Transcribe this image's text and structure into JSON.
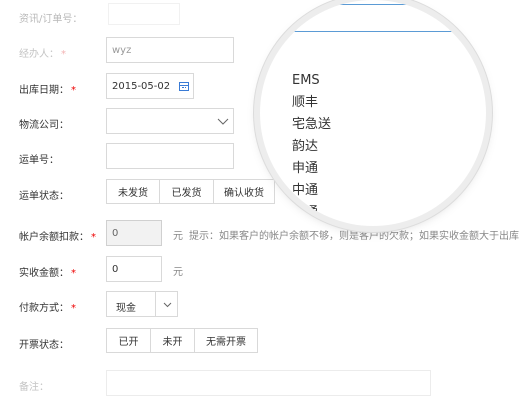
{
  "form": {
    "order_no": {
      "label": "资讯/订单号：",
      "value": ""
    },
    "handler": {
      "label": "经办人：",
      "required": "*",
      "value": "wyz"
    },
    "ship_date": {
      "label": "出库日期：",
      "required": "*",
      "value": "2015-05-02",
      "icon": "calendar-icon"
    },
    "logistics": {
      "label": "物流公司：",
      "icon": "chevron-down-icon"
    },
    "tracking_no": {
      "label": "运单号："
    },
    "shipping_status": {
      "label": "运单状态：",
      "options": [
        "未发货",
        "已发货",
        "确认收货"
      ]
    },
    "balance_deduct": {
      "label": "帐户余额扣款：",
      "required": "*",
      "value": "0",
      "unit": "元",
      "hint": "提示：如果客户的帐户余额不够，则是客户的欠款；如果实收金额大于出库"
    },
    "received_amount": {
      "label": "实收金额：",
      "required": "*",
      "value": "0",
      "unit": "元"
    },
    "payment_method": {
      "label": "付款方式：",
      "required": "*",
      "value": "现金",
      "icon": "chevron-down-icon"
    },
    "invoice_status": {
      "label": "开票状态：",
      "options": [
        "已开",
        "未开",
        "无需开票"
      ]
    },
    "remark": {
      "label": "备注："
    }
  },
  "magnifier": {
    "input_value": "",
    "items": [
      "EMS",
      "顺丰",
      "宅急送",
      "韵达",
      "申通",
      "中通",
      "圆通"
    ]
  }
}
